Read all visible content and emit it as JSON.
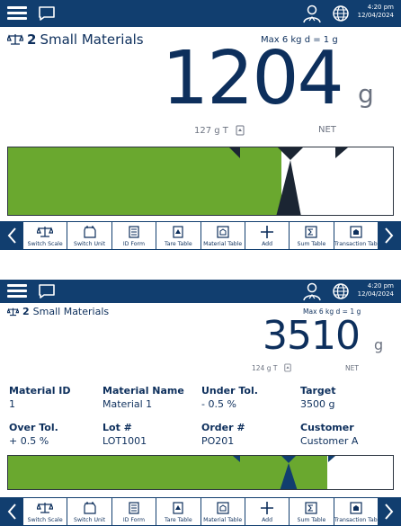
{
  "colors": {
    "header": "#113e6f",
    "bar_green": "#6aa82f",
    "text": "#0d2f5c"
  },
  "icons": [
    "menu-icon",
    "message-icon",
    "user-icon",
    "globe-icon",
    "balance-icon",
    "tare-icon"
  ],
  "screen1": {
    "clock_time": "4:20 pm",
    "clock_date": "12/04/2024",
    "scale_number": "2",
    "scale_name": "Small Materials",
    "max_text": "Max 6 kg  d = 1 g",
    "weight": "1204",
    "unit": "g",
    "tare": "127 g T",
    "net": "NET",
    "bargraph": {
      "fill_fraction": 0.71
    },
    "softkeys": [
      "Switch Scale",
      "Switch Unit",
      "ID Form",
      "Tare Table",
      "Material Table",
      "Add",
      "Sum Table",
      "Transaction Table"
    ]
  },
  "screen2": {
    "clock_time": "4:20 pm",
    "clock_date": "12/04/2024",
    "scale_number": "2",
    "scale_name": "Small Materials",
    "max_text": "Max 6 kg d = 1 g",
    "weight": "3510",
    "unit": "g",
    "tare": "124 g T",
    "net": "NET",
    "bargraph": {
      "fill_fraction": 0.83
    },
    "fields": [
      {
        "label": "Material ID",
        "value": "1"
      },
      {
        "label": "Material Name",
        "value": "Material 1"
      },
      {
        "label": "Under Tol.",
        "value": "- 0.5 %"
      },
      {
        "label": "Target",
        "value": "3500 g"
      },
      {
        "label": "Over Tol.",
        "value": "+ 0.5 %"
      },
      {
        "label": "Lot #",
        "value": "LOT1001"
      },
      {
        "label": "Order #",
        "value": "PO201"
      },
      {
        "label": "Customer",
        "value": "Customer A"
      }
    ],
    "softkeys": [
      "Switch Scale",
      "Switch Unit",
      "ID Form",
      "Tare Table",
      "Material Table",
      "Add",
      "Sum Table",
      "Transaction Table"
    ]
  }
}
